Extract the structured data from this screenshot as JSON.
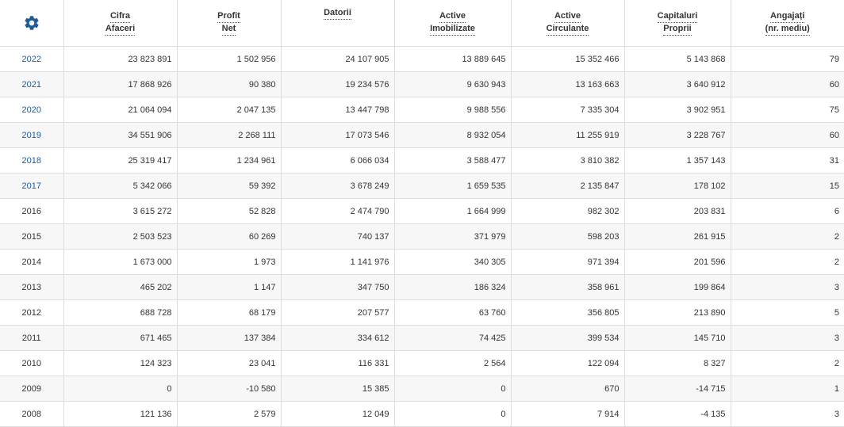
{
  "header": {
    "settings_icon": "gear-icon",
    "columns": [
      {
        "line1": "Cifra",
        "line2": "Afaceri"
      },
      {
        "line1": "Profit",
        "line2": "Net"
      },
      {
        "line1": "Datorii",
        "line2": ""
      },
      {
        "line1": "Active",
        "line2": "Imobilizate"
      },
      {
        "line1": "Active",
        "line2": "Circulante"
      },
      {
        "line1": "Capitaluri",
        "line2": "Proprii"
      },
      {
        "line1": "Angajați",
        "line2": "(nr. mediu)"
      }
    ]
  },
  "colors": {
    "link": "#1f5b99",
    "gear": "#1f5b99",
    "border": "#dddddd",
    "stripe": "#f7f7f7"
  },
  "rows": [
    {
      "year": "2022",
      "link": true,
      "cells": [
        "23 823 891",
        "1 502 956",
        "24 107 905",
        "13 889 645",
        "15 352 466",
        "5 143 868",
        "79"
      ]
    },
    {
      "year": "2021",
      "link": true,
      "cells": [
        "17 868 926",
        "90 380",
        "19 234 576",
        "9 630 943",
        "13 163 663",
        "3 640 912",
        "60"
      ]
    },
    {
      "year": "2020",
      "link": true,
      "cells": [
        "21 064 094",
        "2 047 135",
        "13 447 798",
        "9 988 556",
        "7 335 304",
        "3 902 951",
        "75"
      ]
    },
    {
      "year": "2019",
      "link": true,
      "cells": [
        "34 551 906",
        "2 268 111",
        "17 073 546",
        "8 932 054",
        "11 255 919",
        "3 228 767",
        "60"
      ]
    },
    {
      "year": "2018",
      "link": true,
      "cells": [
        "25 319 417",
        "1 234 961",
        "6 066 034",
        "3 588 477",
        "3 810 382",
        "1 357 143",
        "31"
      ]
    },
    {
      "year": "2017",
      "link": true,
      "cells": [
        "5 342 066",
        "59 392",
        "3 678 249",
        "1 659 535",
        "2 135 847",
        "178 102",
        "15"
      ]
    },
    {
      "year": "2016",
      "link": false,
      "cells": [
        "3 615 272",
        "52 828",
        "2 474 790",
        "1 664 999",
        "982 302",
        "203 831",
        "6"
      ]
    },
    {
      "year": "2015",
      "link": false,
      "cells": [
        "2 503 523",
        "60 269",
        "740 137",
        "371 979",
        "598 203",
        "261 915",
        "2"
      ]
    },
    {
      "year": "2014",
      "link": false,
      "cells": [
        "1 673 000",
        "1 973",
        "1 141 976",
        "340 305",
        "971 394",
        "201 596",
        "2"
      ]
    },
    {
      "year": "2013",
      "link": false,
      "cells": [
        "465 202",
        "1 147",
        "347 750",
        "186 324",
        "358 961",
        "199 864",
        "3"
      ]
    },
    {
      "year": "2012",
      "link": false,
      "cells": [
        "688 728",
        "68 179",
        "207 577",
        "63 760",
        "356 805",
        "213 890",
        "5"
      ]
    },
    {
      "year": "2011",
      "link": false,
      "cells": [
        "671 465",
        "137 384",
        "334 612",
        "74 425",
        "399 534",
        "145 710",
        "3"
      ]
    },
    {
      "year": "2010",
      "link": false,
      "cells": [
        "124 323",
        "23 041",
        "116 331",
        "2 564",
        "122 094",
        "8 327",
        "2"
      ]
    },
    {
      "year": "2009",
      "link": false,
      "cells": [
        "0",
        "-10 580",
        "15 385",
        "0",
        "670",
        "-14 715",
        "1"
      ]
    },
    {
      "year": "2008",
      "link": false,
      "cells": [
        "121 136",
        "2 579",
        "12 049",
        "0",
        "7 914",
        "-4 135",
        "3"
      ]
    }
  ]
}
